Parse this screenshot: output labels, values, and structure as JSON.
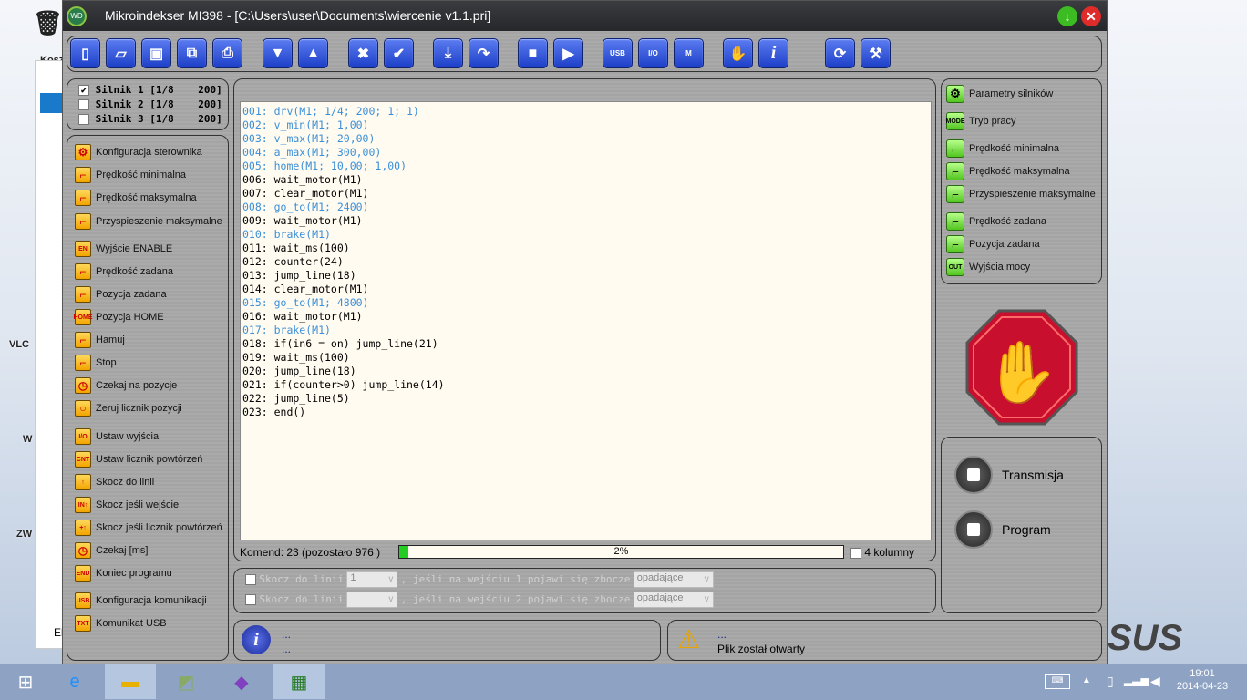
{
  "desktop": {
    "icons": [
      "Kosz",
      "VLC",
      "W",
      "ZW"
    ],
    "explorer_bottom": "El"
  },
  "window": {
    "title": "Mikroindekser MI398  -  [C:\\Users\\user\\Documents\\wiercenie v1.1.pri]",
    "logo": "WD"
  },
  "toolbar": [
    "new-file",
    "open",
    "save",
    "save-all",
    "print",
    "move-down",
    "move-up",
    "delete",
    "confirm",
    "download",
    "redo",
    "stop",
    "play",
    "usb",
    "io",
    "motor",
    "hand",
    "info",
    "refresh",
    "tools"
  ],
  "toolbar_labels": {
    "usb": "USB",
    "io": "I/O",
    "motor": "M",
    "info": "i"
  },
  "motors": [
    {
      "label": "Silnik 1 [1/8    200]",
      "checked": true
    },
    {
      "label": "Silnik 2 [1/8    200]",
      "checked": false
    },
    {
      "label": "Silnik 3 [1/8    200]",
      "checked": false
    }
  ],
  "commands": [
    {
      "label": "Konfiguracja sterownika",
      "icon": "gear"
    },
    {
      "label": "Prędkość minimalna",
      "icon": "ramp"
    },
    {
      "label": "Prędkość maksymalna",
      "icon": "ramp"
    },
    {
      "label": "Przyspieszenie maksymalne",
      "icon": "ramp"
    },
    {
      "label": "Wyjście ENABLE",
      "icon": "EN"
    },
    {
      "label": "Prędkość zadana",
      "icon": "ramp"
    },
    {
      "label": "Pozycja zadana",
      "icon": "ramp"
    },
    {
      "label": "Pozycja HOME",
      "icon": "HOME"
    },
    {
      "label": "Hamuj",
      "icon": "ramp"
    },
    {
      "label": "Stop",
      "icon": "ramp"
    },
    {
      "label": "Czekaj na pozycje",
      "icon": "clock"
    },
    {
      "label": "Zeruj licznik pozycji",
      "icon": "circle"
    },
    {
      "label": "Ustaw wyjścia",
      "icon": "I/O"
    },
    {
      "label": "Ustaw licznik powtórzeń",
      "icon": "CNT"
    },
    {
      "label": "Skocz do linii",
      "icon": "↑"
    },
    {
      "label": "Skocz jeśli wejście",
      "icon": "IN↑"
    },
    {
      "label": "Skocz jeśli licznik powtórzeń",
      "icon": "+↑"
    },
    {
      "label": "Czekaj [ms]",
      "icon": "clock"
    },
    {
      "label": "Koniec programu",
      "icon": "END"
    },
    {
      "label": "Konfiguracja komunikacji",
      "icon": "USB"
    },
    {
      "label": "Komunikat USB",
      "icon": "TXT"
    }
  ],
  "code": [
    {
      "text": "001: drv(M1; 1/4; 200; 1; 1)",
      "blue": true
    },
    {
      "text": "002: v_min(M1; 1,00)",
      "blue": true
    },
    {
      "text": "003: v_max(M1; 20,00)",
      "blue": true
    },
    {
      "text": "004: a_max(M1; 300,00)",
      "blue": true
    },
    {
      "text": "005: home(M1; 10,00; 1,00)",
      "blue": true
    },
    {
      "text": "006: wait_motor(M1)",
      "blue": false
    },
    {
      "text": "007: clear_motor(M1)",
      "blue": false
    },
    {
      "text": "008: go_to(M1; 2400)",
      "blue": true
    },
    {
      "text": "009: wait_motor(M1)",
      "blue": false
    },
    {
      "text": "010: brake(M1)",
      "blue": true
    },
    {
      "text": "011: wait_ms(100)",
      "blue": false
    },
    {
      "text": "012: counter(24)",
      "blue": false
    },
    {
      "text": "013: jump_line(18)",
      "blue": false
    },
    {
      "text": "014: clear_motor(M1)",
      "blue": false
    },
    {
      "text": "015: go_to(M1; 4800)",
      "blue": true
    },
    {
      "text": "016: wait_motor(M1)",
      "blue": false
    },
    {
      "text": "017: brake(M1)",
      "blue": true
    },
    {
      "text": "018: if(in6 = on) jump_line(21)",
      "blue": false
    },
    {
      "text": "019: wait_ms(100)",
      "blue": false
    },
    {
      "text": "020: jump_line(18)",
      "blue": false
    },
    {
      "text": "021: if(counter>0) jump_line(14)",
      "blue": false
    },
    {
      "text": "022: jump_line(5)",
      "blue": false
    },
    {
      "text": "023: end()",
      "blue": false
    }
  ],
  "status": {
    "commands": "Komend: 23 (pozostało 976 )",
    "progress_percent": 2,
    "progress_label": "2%",
    "four_columns": "4 kolumny"
  },
  "jumps": [
    {
      "label": "Skocz do linii",
      "line": "1",
      "mid": ", jeśli na wejściu 1 pojawi się zbocze",
      "edge": "opadające"
    },
    {
      "label": "Skocz do linii",
      "line": "",
      "mid": ", jeśli na wejściu 2 pojawi się zbocze",
      "edge": "opadające"
    }
  ],
  "info": {
    "line1": "...",
    "line2": "..."
  },
  "warning": {
    "line1": "...",
    "line2": "Plik został otwarty"
  },
  "right_menu": [
    {
      "label": "Parametry silników",
      "icon": "gear"
    },
    {
      "label": "Tryb pracy",
      "icon": "MODE"
    },
    {
      "label": "Prędkość minimalna",
      "icon": "ramp"
    },
    {
      "label": "Prędkość maksymalna",
      "icon": "ramp"
    },
    {
      "label": "Przyspieszenie maksymalne",
      "icon": "ramp"
    },
    {
      "label": "Prędkość zadana",
      "icon": "ramp"
    },
    {
      "label": "Pozycja zadana",
      "icon": "ramp"
    },
    {
      "label": "Wyjścia mocy",
      "icon": "OUT"
    }
  ],
  "transmission": "Transmisja",
  "program": "Program",
  "brand": "SUS",
  "clock": {
    "time": "19:01",
    "date": "2014-04-23"
  },
  "colors": {
    "code_blue": "#3b8fd8",
    "toolbar_blue": "#1d3fc8",
    "progress": "#22cc22",
    "stop_red": "#c8102e"
  }
}
